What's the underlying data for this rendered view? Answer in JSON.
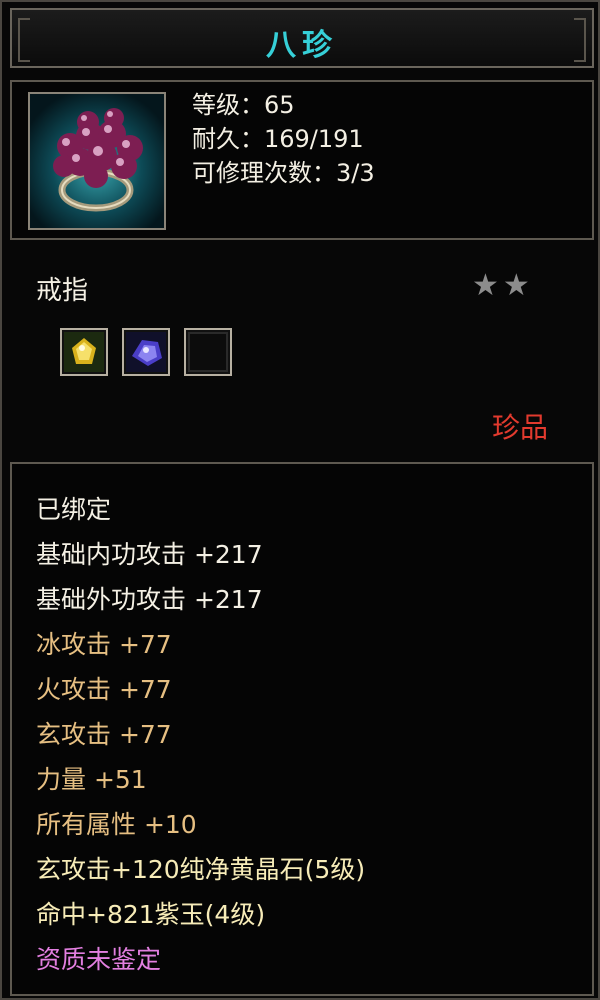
{
  "item": {
    "name": "八珍",
    "level": "等级：65",
    "durability": "耐久：169/191",
    "repairs": "可修理次数：3/3",
    "type": "戒指",
    "stars": "★★",
    "rarity": "珍品",
    "sockets": [
      "yellow-gem-icon",
      "purple-gem-icon",
      "empty-socket-icon"
    ]
  },
  "attributes": [
    {
      "text": "已绑定",
      "style": "white"
    },
    {
      "text": "基础内功攻击 +217",
      "style": "white"
    },
    {
      "text": "基础外功攻击 +217",
      "style": "white"
    },
    {
      "text": "冰攻击 +77",
      "style": "gold"
    },
    {
      "text": "火攻击 +77",
      "style": "gold"
    },
    {
      "text": "玄攻击 +77",
      "style": "gold"
    },
    {
      "text": "力量 +51",
      "style": "gold"
    },
    {
      "text": "所有属性 +10",
      "style": "gold"
    },
    {
      "text": "玄攻击+120纯净黄晶石(5级)",
      "style": "yellow"
    },
    {
      "text": "命中+821紫玉(4级)",
      "style": "yellow"
    },
    {
      "text": "资质未鉴定",
      "style": "pink"
    }
  ]
}
